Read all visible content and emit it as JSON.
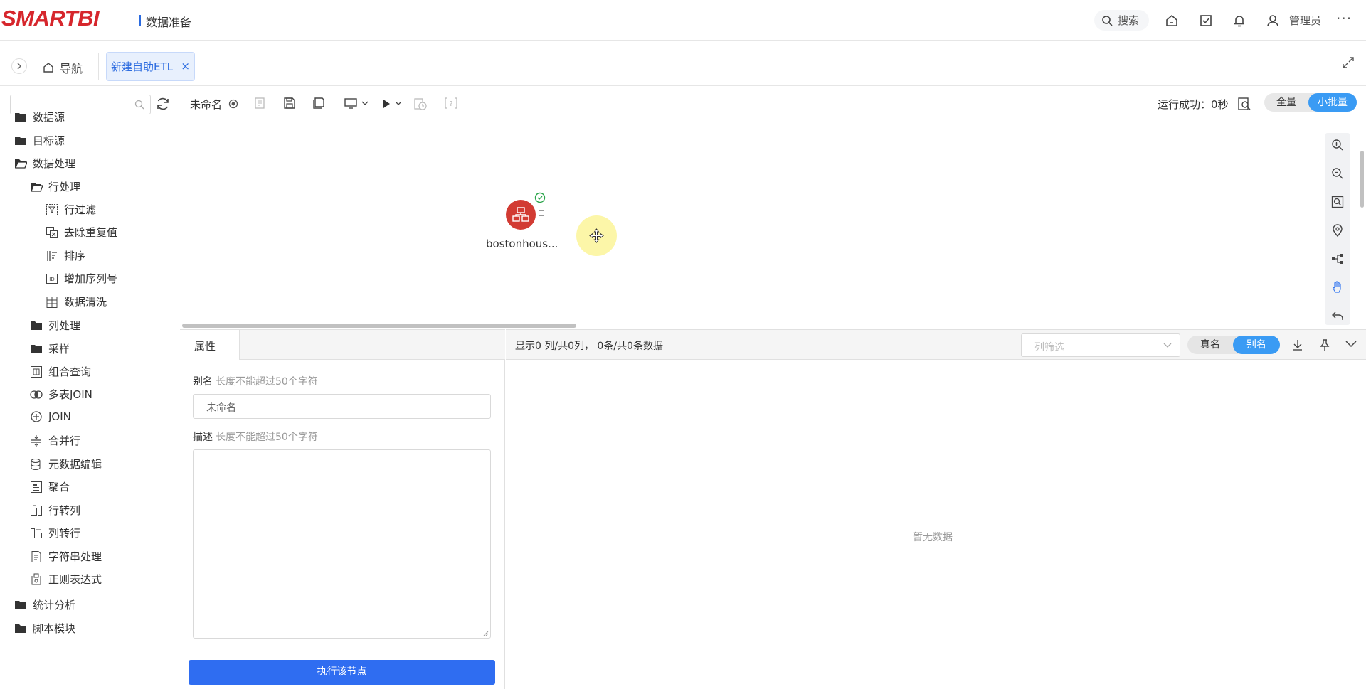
{
  "header": {
    "logo": "SMARTBI",
    "app_title": "数据准备",
    "search_label": "搜索",
    "user_label": "管理员",
    "more": "···"
  },
  "tabbar": {
    "nav_label": "导航",
    "active_tab": "新建自助ETL",
    "close": "×"
  },
  "tree": {
    "search_placeholder": "",
    "items": [
      {
        "label": "数据源",
        "icon": "folder-icon"
      },
      {
        "label": "目标源",
        "icon": "folder-icon"
      },
      {
        "label": "数据处理",
        "icon": "folder-open-icon"
      },
      {
        "label": "行处理",
        "icon": "folder-open-icon"
      },
      {
        "label": "行过滤",
        "icon": "filter-icon"
      },
      {
        "label": "去除重复值",
        "icon": "dedupe-icon"
      },
      {
        "label": "排序",
        "icon": "sort-icon"
      },
      {
        "label": "增加序列号",
        "icon": "id-icon"
      },
      {
        "label": "数据清洗",
        "icon": "clean-icon"
      },
      {
        "label": "列处理",
        "icon": "folder-icon"
      },
      {
        "label": "采样",
        "icon": "folder-icon"
      },
      {
        "label": "组合查询",
        "icon": "query-icon"
      },
      {
        "label": "多表JOIN",
        "icon": "join-icon"
      },
      {
        "label": "JOIN",
        "icon": "plus-circle-icon"
      },
      {
        "label": "合并行",
        "icon": "merge-icon"
      },
      {
        "label": "元数据编辑",
        "icon": "database-icon"
      },
      {
        "label": "聚合",
        "icon": "aggregate-icon"
      },
      {
        "label": "行转列",
        "icon": "row-to-col-icon"
      },
      {
        "label": "列转行",
        "icon": "col-to-row-icon"
      },
      {
        "label": "字符串处理",
        "icon": "document-icon"
      },
      {
        "label": "正则表达式",
        "icon": "regex-icon"
      },
      {
        "label": "统计分析",
        "icon": "folder-icon"
      },
      {
        "label": "脚本模块",
        "icon": "folder-icon"
      }
    ]
  },
  "toolbar": {
    "etl_name": "未命名",
    "run_status": "运行成功：0秒",
    "mode_full": "全量",
    "mode_small": "小批量"
  },
  "canvas": {
    "node_label": "bostonhous..."
  },
  "props": {
    "tab_label": "属性",
    "alias_label": "别名",
    "alias_hint": "长度不能超过50个字符",
    "alias_value": "未命名",
    "desc_label": "描述",
    "desc_hint": "长度不能超过50个字符",
    "exec_button": "执行该节点"
  },
  "preview": {
    "info": "显示0 列/共0列，  0条/共0条数据",
    "column_filter_placeholder": "列筛选",
    "real_name": "真名",
    "alias_name": "别名",
    "empty_text": "暂无数据"
  },
  "colors": {
    "brand_red": "#d6262c",
    "primary_blue": "#2f6df1",
    "toggle_blue": "#3a9bf4",
    "node_red": "#d23b33"
  }
}
